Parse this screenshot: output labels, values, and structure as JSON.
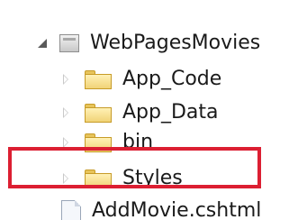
{
  "tree": {
    "root": {
      "label": "WebPagesMovies",
      "icon": "project-icon",
      "expanded": true
    },
    "items": [
      {
        "label": "App_Code",
        "icon": "folder-icon"
      },
      {
        "label": "App_Data",
        "icon": "folder-icon"
      },
      {
        "label": "bin",
        "icon": "folder-icon"
      },
      {
        "label": "Styles",
        "icon": "folder-icon"
      },
      {
        "label": "AddMovie.cshtml",
        "icon": "file-icon"
      }
    ]
  },
  "highlight": {
    "color": "#dc1f32",
    "target": "Styles"
  }
}
